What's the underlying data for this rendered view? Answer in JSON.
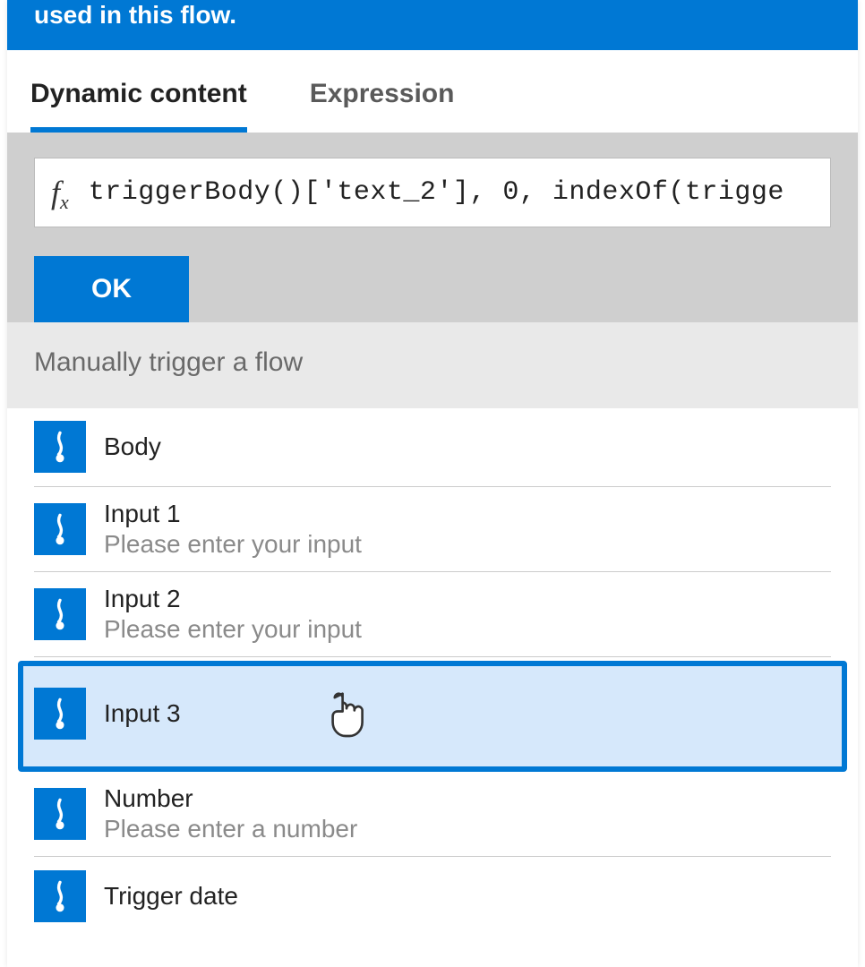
{
  "header": {
    "text": "used in this flow."
  },
  "tabs": {
    "dynamic": "Dynamic content",
    "expression": "Expression"
  },
  "expression": {
    "fx": "fx",
    "value": "triggerBody()['text_2'], 0, indexOf(trigge",
    "ok": "OK"
  },
  "section": {
    "title": "Manually trigger a flow"
  },
  "items": [
    {
      "title": "Body",
      "desc": ""
    },
    {
      "title": "Input 1",
      "desc": "Please enter your input"
    },
    {
      "title": "Input 2",
      "desc": "Please enter your input"
    },
    {
      "title": "Input 3",
      "desc": "",
      "highlight": true
    },
    {
      "title": "Number",
      "desc": "Please enter a number"
    },
    {
      "title": "Trigger date",
      "desc": ""
    }
  ]
}
